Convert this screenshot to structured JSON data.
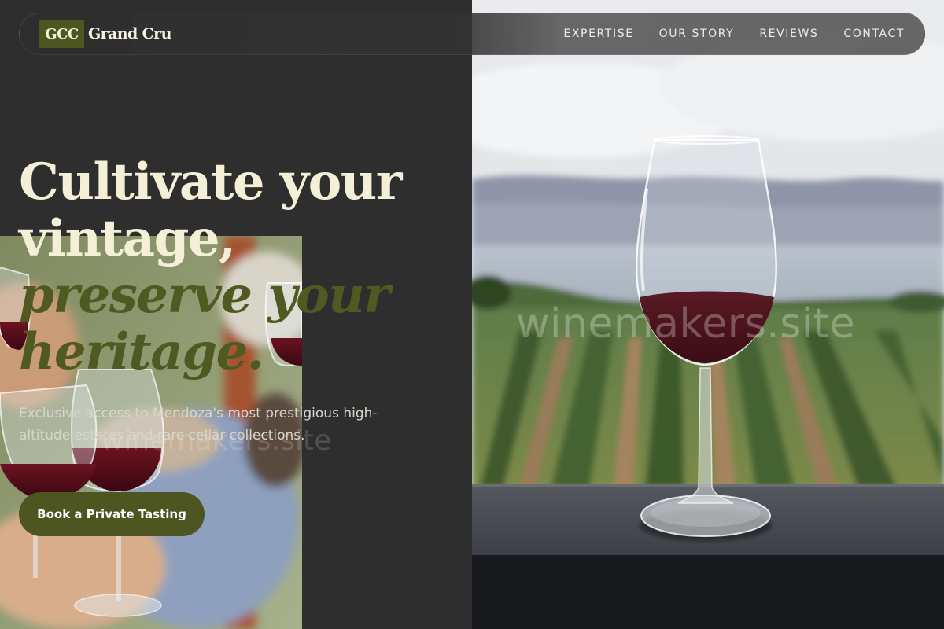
{
  "brand": {
    "badge": "GCC",
    "name": "Grand Cru"
  },
  "nav": {
    "items": [
      {
        "label": "EXPERTISE"
      },
      {
        "label": "OUR STORY"
      },
      {
        "label": "REVIEWS"
      },
      {
        "label": "CONTACT"
      }
    ]
  },
  "hero": {
    "headline_line1": "Cultivate your",
    "headline_line2": "vintage,",
    "headline_line3": "preserve your",
    "headline_line4": "heritage.",
    "subtext": "Exclusive access to Mendoza's most prestigious high-altitude estates and rare cellar collections.",
    "cta_label": "Book a Private Tasting"
  },
  "watermark": {
    "text": "winemakers.site"
  },
  "colors": {
    "accent": "#4d5520",
    "background": "#2e2e2e",
    "headline_light": "#f4f0d8",
    "headline_olive": "#4f5a22"
  }
}
